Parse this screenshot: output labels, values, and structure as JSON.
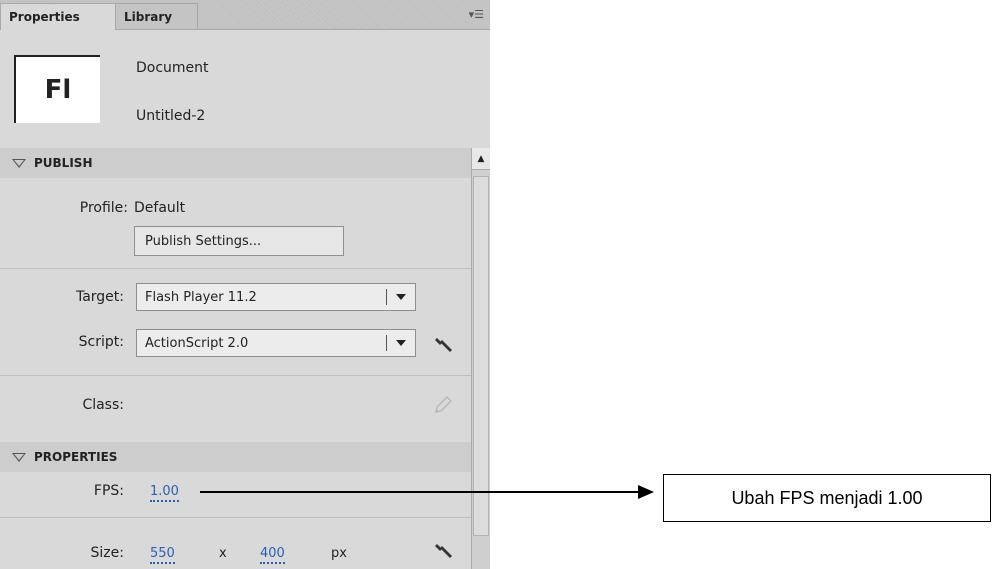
{
  "tabs": [
    {
      "label": "Properties",
      "active": true
    },
    {
      "label": "Library",
      "active": false
    }
  ],
  "panel_menu_icon": "panel-menu-icon",
  "document": {
    "icon_text": "Fl",
    "type": "Document",
    "name": "Untitled-2"
  },
  "publish": {
    "header": "PUBLISH",
    "profile_label": "Profile:",
    "profile_value": "Default",
    "settings_button": "Publish Settings...",
    "target_label": "Target:",
    "target_value": "Flash Player 11.2",
    "script_label": "Script:",
    "script_value": "ActionScript 2.0",
    "class_label": "Class:"
  },
  "properties": {
    "header": "PROPERTIES",
    "fps_label": "FPS:",
    "fps_value": "1.00",
    "size_label": "Size:",
    "width": "550",
    "x": "x",
    "height": "400",
    "unit": "px"
  },
  "annotation": {
    "text": "Ubah FPS menjadi 1.00"
  },
  "colors": {
    "panel_bg": "#d9d9d9",
    "link_blue": "#2a60b8"
  }
}
